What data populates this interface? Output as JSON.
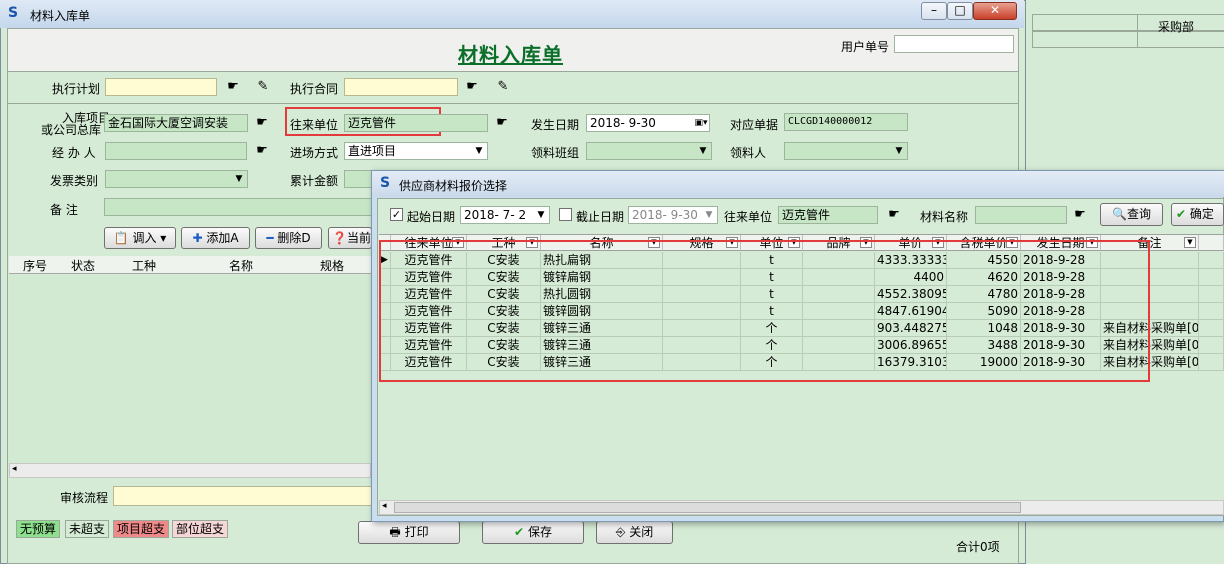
{
  "background": {
    "dept_label": "采购部"
  },
  "main": {
    "window_title": "材料入库单",
    "form_title": "材料入库单",
    "user_no_label": "用户单号",
    "exec_plan_label": "执行计划",
    "exec_contract_label": "执行合同",
    "project_label_1": "入库项目",
    "project_label_2": "或公司总库",
    "project_value": "金石国际大厦空调安装",
    "partner_label": "往来单位",
    "partner_value": "迈克管件",
    "date_label": "发生日期",
    "date_value": "2018- 9-30",
    "doc_label": "对应单据",
    "doc_value": "CLCGD140000012",
    "handler_label": "经 办 人",
    "entry_mode_label": "进场方式",
    "entry_mode_value": "直进项目",
    "team_label": "领料班组",
    "receiver_label": "领料人",
    "invoice_label": "发票类别",
    "total_label": "累计金额",
    "remark_label": "备    注",
    "btn_import": "调入",
    "btn_add": "添加A",
    "btn_delete": "删除D",
    "btn_current": "当前",
    "grid_headers": [
      "序号",
      "状态",
      "工种",
      "名称",
      "规格"
    ],
    "audit_label": "审核流程",
    "legend": [
      "无预算",
      "未超支",
      "项目超支",
      "部位超支"
    ],
    "btn_print": "打印",
    "btn_save": "保存",
    "btn_close": "关闭",
    "total_count": "合计0项"
  },
  "dialog": {
    "title": "供应商材料报价选择",
    "start_date_label": "起始日期",
    "start_date_value": "2018- 7- 2",
    "end_date_label": "截止日期",
    "end_date_value": "2018- 9-30",
    "partner_label": "往来单位",
    "partner_value": "迈克管件",
    "material_label": "材料名称",
    "btn_query": "查询",
    "btn_ok": "确定",
    "columns": [
      "往来单位",
      "工种",
      "名称",
      "规格",
      "单位",
      "品牌",
      "单价",
      "含税单价",
      "发生日期",
      "备注"
    ],
    "rows": [
      [
        "迈克管件",
        "C安装",
        "热扎扁钢",
        "",
        "t",
        "",
        "4333.333333",
        "4550",
        "2018-9-28",
        ""
      ],
      [
        "迈克管件",
        "C安装",
        "镀锌扁钢",
        "",
        "t",
        "",
        "4400",
        "4620",
        "2018-9-28",
        ""
      ],
      [
        "迈克管件",
        "C安装",
        "热扎圆钢",
        "",
        "t",
        "",
        "4552.380952",
        "4780",
        "2018-9-28",
        ""
      ],
      [
        "迈克管件",
        "C安装",
        "镀锌圆钢",
        "",
        "t",
        "",
        "4847.619047",
        "5090",
        "2018-9-28",
        ""
      ],
      [
        "迈克管件",
        "C安装",
        "镀锌三通",
        "",
        "个",
        "",
        "903.4482758",
        "1048",
        "2018-9-30",
        "来自材料采购单[0"
      ],
      [
        "迈克管件",
        "C安装",
        "镀锌三通",
        "",
        "个",
        "",
        "3006.896551",
        "3488",
        "2018-9-30",
        "来自材料采购单[0"
      ],
      [
        "迈克管件",
        "C安装",
        "镀锌三通",
        "",
        "个",
        "",
        "16379.31034",
        "19000",
        "2018-9-30",
        "来自材料采购单[0"
      ]
    ]
  }
}
